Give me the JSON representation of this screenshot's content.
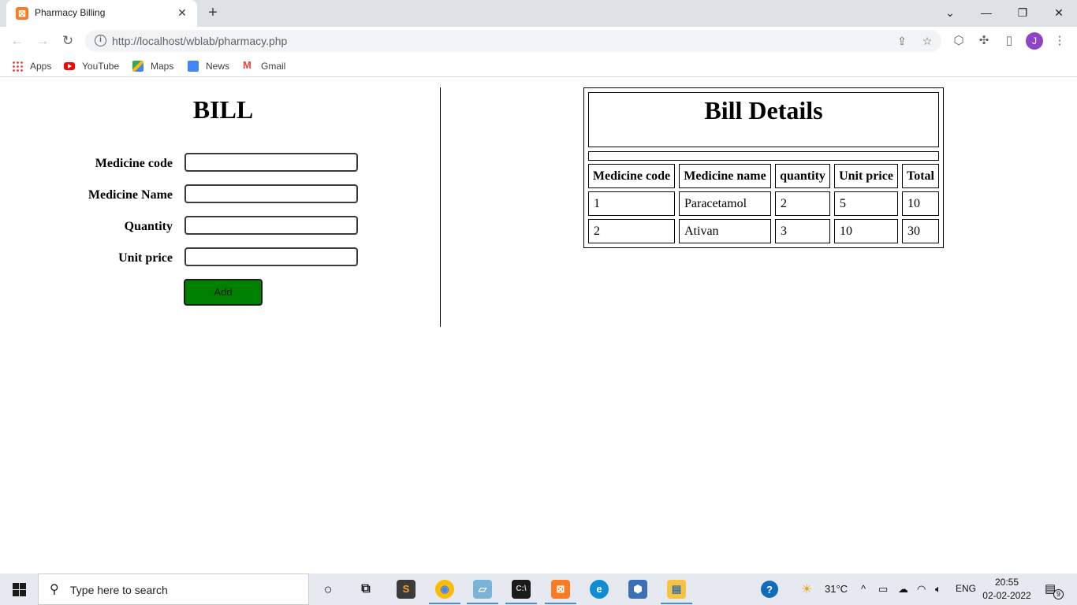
{
  "browser": {
    "tab_title": "Pharmacy Billing",
    "url": "http://localhost/wblab/pharmacy.php",
    "bookmarks": [
      "Apps",
      "YouTube",
      "Maps",
      "News",
      "Gmail"
    ],
    "profile_initial": "J"
  },
  "form": {
    "title": "BILL",
    "fields": [
      {
        "label": "Medicine code",
        "value": ""
      },
      {
        "label": "Medicine Name",
        "value": ""
      },
      {
        "label": "Quantity",
        "value": ""
      },
      {
        "label": "Unit price",
        "value": ""
      }
    ],
    "add_label": "Add"
  },
  "bill": {
    "title": "Bill Details",
    "headers": [
      "Medicine code",
      "Medicine name",
      "quantity",
      "Unit price",
      "Total"
    ],
    "rows": [
      [
        "1",
        "Paracetamol",
        "2",
        "5",
        "10"
      ],
      [
        "2",
        "Ativan",
        "3",
        "10",
        "30"
      ]
    ]
  },
  "taskbar": {
    "search_placeholder": "Type here to search",
    "weather": "31°C",
    "language": "ENG",
    "time": "20:55",
    "date": "02-02-2022",
    "notification_count": "9"
  },
  "colors": {
    "add_button": "#008000",
    "profile": "#8e44c4",
    "tabstrip": "#dee1e6"
  }
}
